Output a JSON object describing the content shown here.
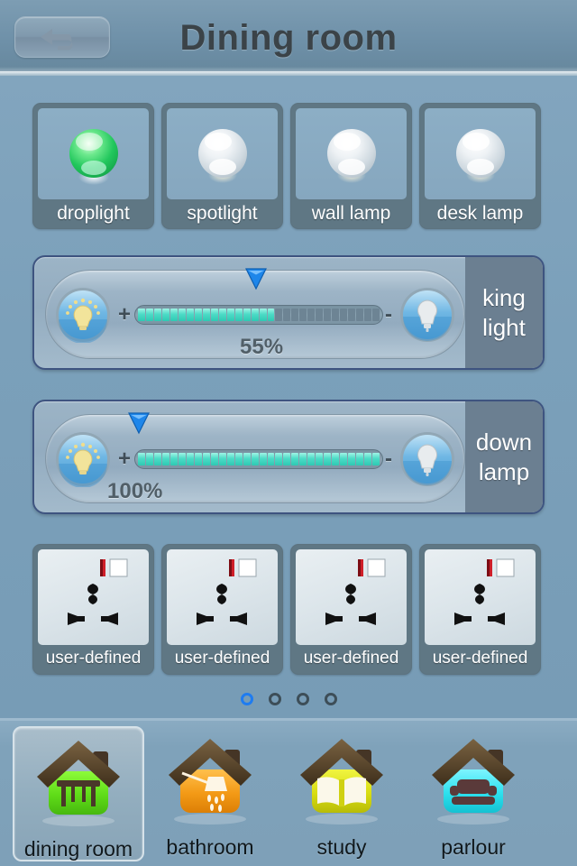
{
  "header": {
    "title": "Dining room",
    "back_label": "Back",
    "back_icon": "undo-arrow-icon"
  },
  "lights": {
    "items": [
      {
        "label": "droplight",
        "state": "on",
        "color": "#2fcf6a",
        "icon": "light-orb-icon"
      },
      {
        "label": "spotlight",
        "state": "off",
        "color": "#e8ecef",
        "icon": "light-orb-icon"
      },
      {
        "label": "wall lamp",
        "state": "off",
        "color": "#e8ecef",
        "icon": "light-orb-icon"
      },
      {
        "label": "desk lamp",
        "state": "off",
        "color": "#e8ecef",
        "icon": "light-orb-icon"
      }
    ]
  },
  "dimmers": [
    {
      "name": "king light",
      "label_line1": "king",
      "label_line2": "light",
      "value": 55,
      "value_text": "55%",
      "segments_total": 30,
      "brighten_label": "+",
      "dim_label": "-",
      "bright_icon": "bulb-bright-icon",
      "dim_icon": "bulb-dim-icon",
      "thumb_icon": "slider-thumb-icon"
    },
    {
      "name": "down lamp",
      "label_line1": "down",
      "label_line2": "lamp",
      "value": 100,
      "value_text": "100%",
      "segments_total": 30,
      "brighten_label": "+",
      "dim_label": "-",
      "bright_icon": "bulb-bright-icon",
      "dim_icon": "bulb-dim-icon",
      "thumb_icon": "slider-thumb-icon"
    }
  ],
  "sockets": {
    "items": [
      {
        "label": "user-defined",
        "icon": "power-socket-icon"
      },
      {
        "label": "user-defined",
        "icon": "power-socket-icon"
      },
      {
        "label": "user-defined",
        "icon": "power-socket-icon"
      },
      {
        "label": "user-defined",
        "icon": "power-socket-icon"
      }
    ]
  },
  "pagination": {
    "total": 4,
    "active_index": 0
  },
  "navbar": {
    "items": [
      {
        "label": "dining room",
        "icon": "house-dining-icon",
        "color": "#5fdc18",
        "selected": true
      },
      {
        "label": "bathroom",
        "icon": "house-shower-icon",
        "color": "#f39a16",
        "selected": false
      },
      {
        "label": "study",
        "icon": "house-book-icon",
        "color": "#d8dd12",
        "selected": false
      },
      {
        "label": "parlour",
        "icon": "house-sofa-icon",
        "color": "#2de0ee",
        "selected": false
      }
    ]
  },
  "theme": {
    "background": "#7fa3bc",
    "accent": "#1f7cf0",
    "slider_fill": "#2ec9b3",
    "panel_border": "#3e5480",
    "tile_label_bg": "#5f7784"
  }
}
